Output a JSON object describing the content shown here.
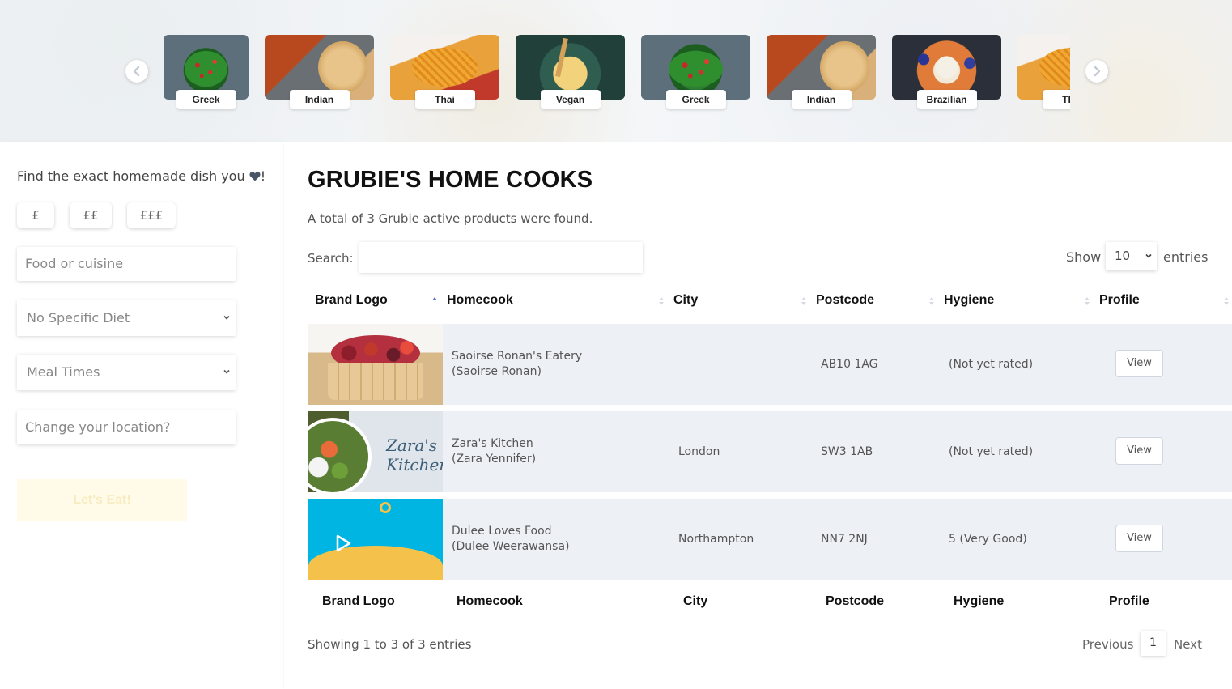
{
  "carousel": {
    "cards": [
      {
        "label": "Greek",
        "icon": "greek-salad-image"
      },
      {
        "label": "Indian",
        "icon": "indian-flatbread-image"
      },
      {
        "label": "Thai",
        "icon": "thai-noodles-image"
      },
      {
        "label": "Vegan",
        "icon": "vegan-bowl-image"
      },
      {
        "label": "Greek",
        "icon": "greek-salad-image"
      },
      {
        "label": "Indian",
        "icon": "indian-flatbread-image"
      },
      {
        "label": "Brazilian",
        "icon": "brazilian-dish-image"
      },
      {
        "label": "Thai",
        "icon": "thai-noodles-image"
      }
    ]
  },
  "sidebar": {
    "intro": "Find the exact homemade dish you",
    "intro_suffix": "!",
    "price_filters": [
      "£",
      "££",
      "£££"
    ],
    "food_placeholder": "Food or cuisine",
    "diet_selected": "No Specific Diet",
    "meal_selected": "Meal Times",
    "location_placeholder": "Change your location?",
    "submit_label": "Let's Eat!"
  },
  "main": {
    "title": "GRUBIE'S HOME COOKS",
    "summary": "A total of 3 Grubie active products were found.",
    "search_label": "Search:",
    "show_label": "Show",
    "entries_value": "10",
    "entries_label": "entries",
    "columns": [
      "Brand Logo",
      "Homecook",
      "City",
      "Postcode",
      "Hygiene",
      "Profile"
    ],
    "rows": [
      {
        "name": "Saoirse Ronan's Eatery",
        "owner": "(Saoirse Ronan)",
        "city": "",
        "postcode": "AB10 1AG",
        "hygiene": "(Not yet rated)",
        "action": "View"
      },
      {
        "name": "Zara's Kitchen",
        "owner": "(Zara Yennifer)",
        "city": "London",
        "postcode": "SW3 1AB",
        "hygiene": "(Not yet rated)",
        "action": "View",
        "logo_text_1": "Zara's",
        "logo_text_2": "Kitchen"
      },
      {
        "name": "Dulee Loves Food",
        "owner": "(Dulee Weerawansa)",
        "city": "Northampton",
        "postcode": "NN7 2NJ",
        "hygiene": "5 (Very Good)",
        "action": "View"
      }
    ],
    "footer_info": "Showing 1 to 3 of 3 entries",
    "pager": {
      "previous": "Previous",
      "page": "1",
      "next": "Next"
    }
  },
  "colors": {
    "row_bg": "#edf0f5",
    "accent_light": "#fffbe8",
    "heart": "#4a5568"
  }
}
